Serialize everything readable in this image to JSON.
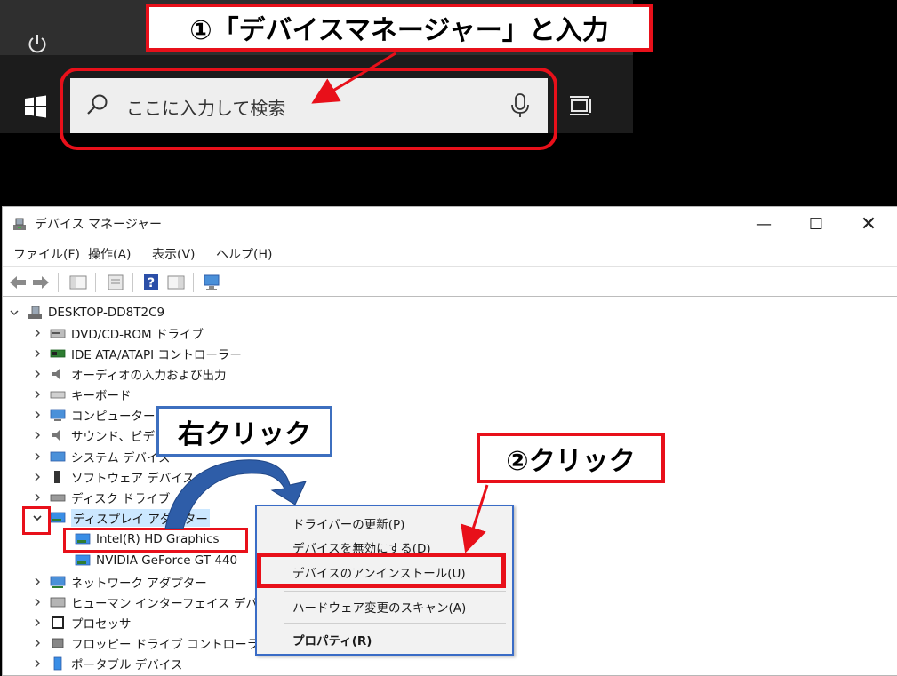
{
  "callouts": {
    "step1": "①「デバイスマネージャー」と入力",
    "right_click": "右クリック",
    "step2": "②クリック"
  },
  "taskbar": {
    "search_placeholder": "ここに入力して検索"
  },
  "window": {
    "title": "デバイス マネージャー",
    "minimize": "—",
    "maximize": "☐",
    "close": "✕"
  },
  "menu": {
    "file": "ファイル(F)",
    "action": "操作(A)",
    "view": "表示(V)",
    "help": "ヘルプ(H)"
  },
  "tree": {
    "root": "DESKTOP-DD8T2C9",
    "items": [
      {
        "label": "DVD/CD-ROM ドライブ",
        "icon": "dvd-drive-icon"
      },
      {
        "label": "IDE ATA/ATAPI コントローラー",
        "icon": "ide-controller-icon"
      },
      {
        "label": "オーディオの入力および出力",
        "icon": "audio-icon"
      },
      {
        "label": "キーボード",
        "icon": "keyboard-icon"
      },
      {
        "label": "コンピューター",
        "icon": "computer-icon"
      },
      {
        "label": "サウンド、ビデオ",
        "icon": "sound-icon"
      },
      {
        "label": "システム デバイス",
        "icon": "system-device-icon"
      },
      {
        "label": "ソフトウェア デバイス",
        "icon": "software-device-icon"
      },
      {
        "label": "ディスク ドライブ",
        "icon": "disk-drive-icon"
      },
      {
        "label": "ディスプレイ アダプター",
        "icon": "display-adapter-icon"
      },
      {
        "label": "Intel(R) HD Graphics",
        "icon": "display-adapter-icon"
      },
      {
        "label": "NVIDIA GeForce GT 440",
        "icon": "display-adapter-icon"
      },
      {
        "label": "ネットワーク アダプター",
        "icon": "network-adapter-icon"
      },
      {
        "label": "ヒューマン インターフェイス デバイス",
        "icon": "hid-icon"
      },
      {
        "label": "プロセッサ",
        "icon": "processor-icon"
      },
      {
        "label": "フロッピー ドライブ コントローラー",
        "icon": "floppy-controller-icon"
      },
      {
        "label": "ポータブル デバイス",
        "icon": "portable-device-icon"
      }
    ]
  },
  "context_menu": {
    "items": [
      "ドライバーの更新(P)",
      "デバイスを無効にする(D)",
      "デバイスのアンインストール(U)",
      "ハードウェア変更のスキャン(A)",
      "プロパティ(R)"
    ]
  },
  "colors": {
    "highlight_red": "#e8101a",
    "callout_blue": "#3d6fbf",
    "selection_blue": "#cce8ff",
    "arrow_blue": "#2e5da8"
  }
}
